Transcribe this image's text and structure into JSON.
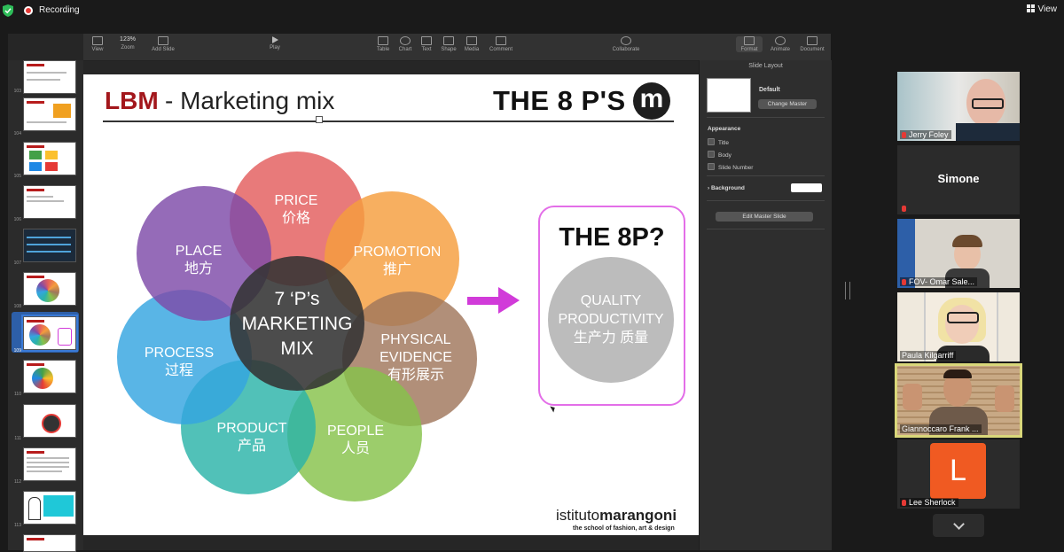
{
  "zoom_meeting": {
    "recording_label": "Recording",
    "view_label": "View"
  },
  "keynote": {
    "toolbar": {
      "view": "View",
      "zoom_value": "123%",
      "zoom": "Zoom",
      "add_slide": "Add Slide",
      "play": "Play",
      "table": "Table",
      "chart": "Chart",
      "text": "Text",
      "shape": "Shape",
      "media": "Media",
      "comment": "Comment",
      "collaborate": "Collaborate",
      "format": "Format",
      "animate": "Animate",
      "document": "Document"
    },
    "navigator": {
      "slide_numbers": [
        "103",
        "104",
        "105",
        "106",
        "107",
        "108",
        "109",
        "110",
        "111",
        "112",
        "113"
      ],
      "selected_slide": "109"
    },
    "inspector": {
      "title": "Slide Layout",
      "layout_name": "Default",
      "change_master": "Change Master",
      "appearance": "Appearance",
      "title_option": "Title",
      "body_option": "Body",
      "slide_number_option": "Slide Number",
      "background": "Background",
      "edit_master": "Edit Master Slide"
    }
  },
  "slide": {
    "title_brand": "LBM",
    "title_rest": "- Marketing mix",
    "header_right": "THE 8 P'S",
    "logo_letter": "m",
    "center": {
      "line1": "7 ‘P’s",
      "line2": "MARKETING",
      "line3": "MIX"
    },
    "petals": {
      "price": {
        "en": "PRICE",
        "zh": "价格"
      },
      "promotion": {
        "en": "PROMOTION",
        "zh": "推广"
      },
      "physical": {
        "en1": "PHYSICAL",
        "en2": "EVIDENCE",
        "zh": "有形展示"
      },
      "people": {
        "en": "PEOPLE",
        "zh": "人员"
      },
      "product": {
        "en": "PRODUCT",
        "zh": "产品"
      },
      "process": {
        "en": "PROCESS",
        "zh": "过程"
      },
      "place": {
        "en": "PLACE",
        "zh": "地方"
      }
    },
    "box": {
      "title": "THE 8P?",
      "line1": "QUALITY",
      "line2": "PRODUCTIVITY",
      "line3": "生产力 质量"
    },
    "brand_name_light": "istituto",
    "brand_name_bold": "marangoni",
    "brand_tagline": "the school of fashion, art & design",
    "colors": {
      "price": "#e35d5d",
      "promotion": "#f59d3d",
      "physical": "#a0765c",
      "people": "#86c24a",
      "product": "#2bb3a8",
      "process": "#34a5e0",
      "place": "#7e4ba8",
      "accent": "#d13bd9",
      "title_red": "#a3171c"
    }
  },
  "participants": [
    {
      "name": "Jerry Foley",
      "muted": true
    },
    {
      "name": "Simone",
      "muted": true
    },
    {
      "name": "FOV- Omar Sale...",
      "muted": true
    },
    {
      "name": "Paula Kilgarriff",
      "muted": false
    },
    {
      "name": "Giannoccaro Frank ...",
      "muted": false,
      "active_speaker": true
    },
    {
      "name": "Lee Sherlock",
      "muted": true,
      "avatar_letter": "L"
    }
  ]
}
